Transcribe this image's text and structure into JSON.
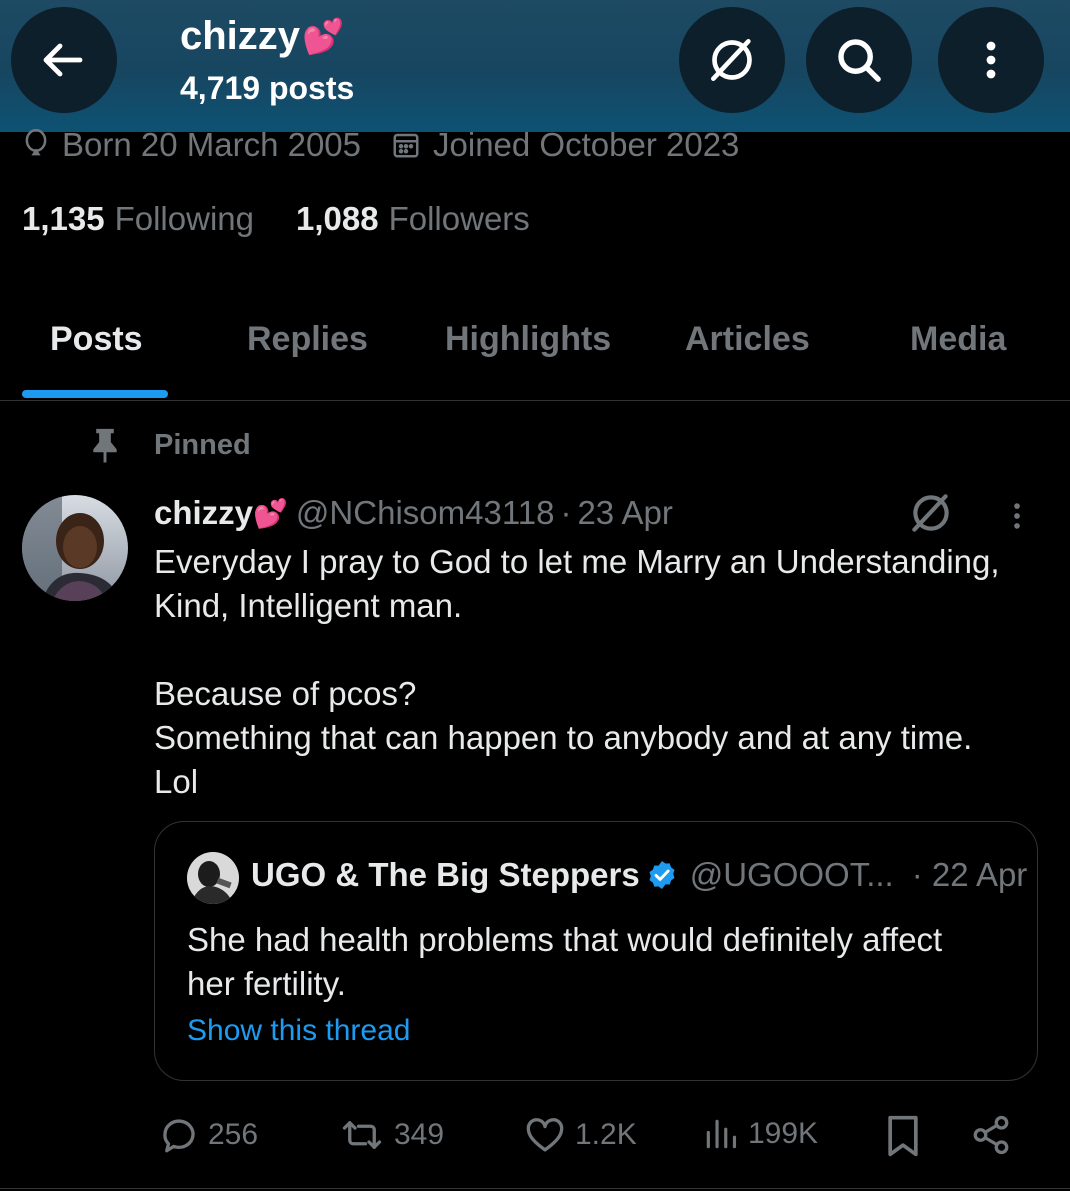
{
  "header": {
    "back_icon": "arrow-left-icon",
    "display_name": "chizzy",
    "name_emoji": "💕",
    "post_count": "4,719 posts",
    "grok_icon": "grok-icon",
    "search_icon": "search-icon",
    "more_icon": "more-vertical-icon",
    "gradient_color": "#174661"
  },
  "profile": {
    "born": "Born 20 March 2005",
    "joined": "Joined October 2023",
    "following_count": "1,135",
    "following_label": "Following",
    "followers_count": "1,088",
    "followers_label": "Followers"
  },
  "tabs": [
    {
      "label": "Posts",
      "active": true
    },
    {
      "label": "Replies",
      "active": false
    },
    {
      "label": "Highlights",
      "active": false
    },
    {
      "label": "Articles",
      "active": false
    },
    {
      "label": "Media",
      "active": false
    }
  ],
  "accent_color": "#1d9bf0",
  "post": {
    "pinned_label": "Pinned",
    "author_name": "chizzy",
    "author_emoji": "💕",
    "handle": "@NChisom43118",
    "separator": "·",
    "date": "23 Apr",
    "text_lines": [
      "Everyday I pray to God to let me Marry an Understanding,",
      "Kind, Intelligent man.",
      "",
      "Because of pcos?",
      "Something that can happen to anybody and at any time.",
      "Lol"
    ],
    "quote": {
      "author_name": "UGO & The Big Steppers",
      "verified_icon": "verified-badge-icon",
      "handle": "@UGOOOT...",
      "date": "· 22 Apr",
      "text_lines": [
        "She had health problems that would definitely affect",
        "her fertility."
      ],
      "show_thread": "Show this thread"
    },
    "actions": {
      "replies": "256",
      "reposts": "349",
      "likes": "1.2K",
      "views": "199K"
    }
  }
}
